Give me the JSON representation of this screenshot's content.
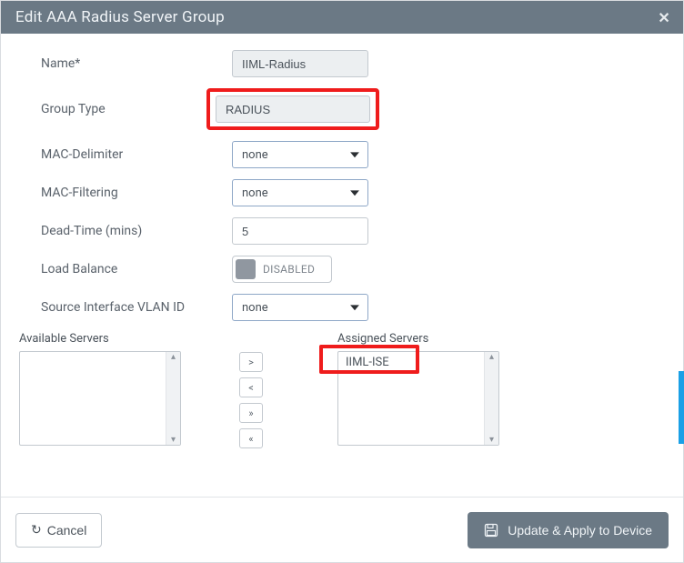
{
  "title": "Edit AAA Radius Server Group",
  "fields": {
    "name": {
      "label": "Name*",
      "value": "IIML-Radius"
    },
    "group_type": {
      "label": "Group Type",
      "value": "RADIUS"
    },
    "mac_delimiter": {
      "label": "MAC-Delimiter",
      "value": "none"
    },
    "mac_filtering": {
      "label": "MAC-Filtering",
      "value": "none"
    },
    "dead_time": {
      "label": "Dead-Time (mins)",
      "value": "5"
    },
    "load_balance": {
      "label": "Load Balance",
      "value": "DISABLED"
    },
    "src_vlan": {
      "label": "Source Interface VLAN ID",
      "value": "none"
    }
  },
  "lists": {
    "available_title": "Available Servers",
    "assigned_title": "Assigned Servers",
    "assigned_item0": "IIML-ISE"
  },
  "mover": {
    "right": ">",
    "left": "<",
    "all_right": "»",
    "all_left": "«"
  },
  "footer": {
    "cancel": "Cancel",
    "apply": "Update & Apply to Device"
  }
}
